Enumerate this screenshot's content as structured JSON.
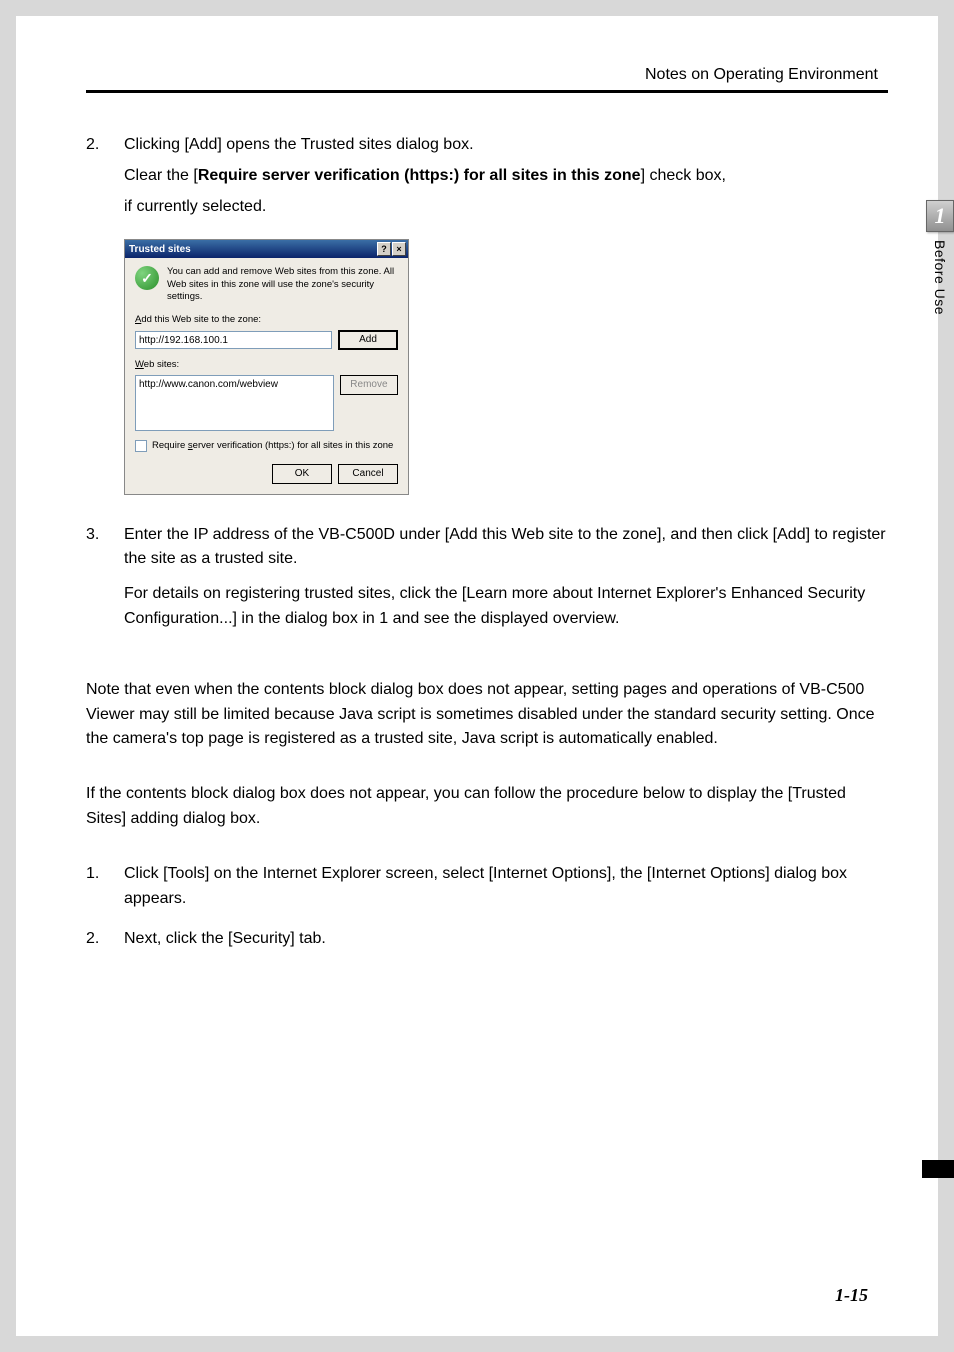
{
  "header": {
    "title": "Notes on Operating Environment"
  },
  "sideTab": {
    "number": "1",
    "label": "Before Use"
  },
  "pageNumber": "1-15",
  "steps_a": [
    {
      "num": "2.",
      "lines": [
        {
          "t": "Clicking [Add] opens the Trusted sites dialog box."
        }
      ],
      "sub": [
        {
          "pre": "Clear the [",
          "bold": "Require server verification (https:) for all sites in this zone",
          "post": "] check box,"
        },
        {
          "t": "if currently selected."
        }
      ]
    }
  ],
  "dialog": {
    "title": "Trusted sites",
    "help": "?",
    "close": "×",
    "introIcon": "✓",
    "intro": "You can add and remove Web sites from this zone. All Web sites in this zone will use the zone's security settings.",
    "addLabelPre": "A",
    "addLabel": "dd this Web site to the zone:",
    "addValue": "http://192.168.100.1",
    "addBtn": "Add",
    "listLabelPre": "W",
    "listLabel": "eb sites:",
    "listItem": "http://www.canon.com/webview",
    "removeBtn": "Remove",
    "checkPre": "Require ",
    "checkUl": "s",
    "checkPost": "erver verification (https:) for all sites in this zone",
    "ok": "OK",
    "cancel": "Cancel"
  },
  "steps_b": [
    {
      "num": "3.",
      "lines": [
        {
          "t": " Enter the IP address of the VB-C500D under [Add this Web site to the zone], and then click [Add] to register the site as a trusted site."
        }
      ],
      "sub": [
        {
          "t": "For details on registering trusted sites, click the [Learn more about Internet Explorer's Enhanced Security Configuration...] in the dialog box in 1 and see the displayed overview."
        }
      ]
    }
  ],
  "paragraphs": [
    "Note that even when the contents block dialog box does not appear, setting pages and operations of VB-C500 Viewer may still be limited because Java script is sometimes disabled under the standard security setting. Once the camera's top page is registered as a trusted site, Java script is automatically enabled.",
    "If the contents block dialog box does not appear, you can follow the procedure below to display the [Trusted Sites] adding dialog box."
  ],
  "steps_c": [
    {
      "num": "1.",
      "lines": [
        {
          "t": "Click [Tools] on the Internet Explorer screen, select [Internet Options], the [Internet Options] dialog box appears."
        }
      ]
    },
    {
      "num": "2.",
      "lines": [
        {
          "t": "Next, click the [Security] tab."
        }
      ]
    }
  ]
}
